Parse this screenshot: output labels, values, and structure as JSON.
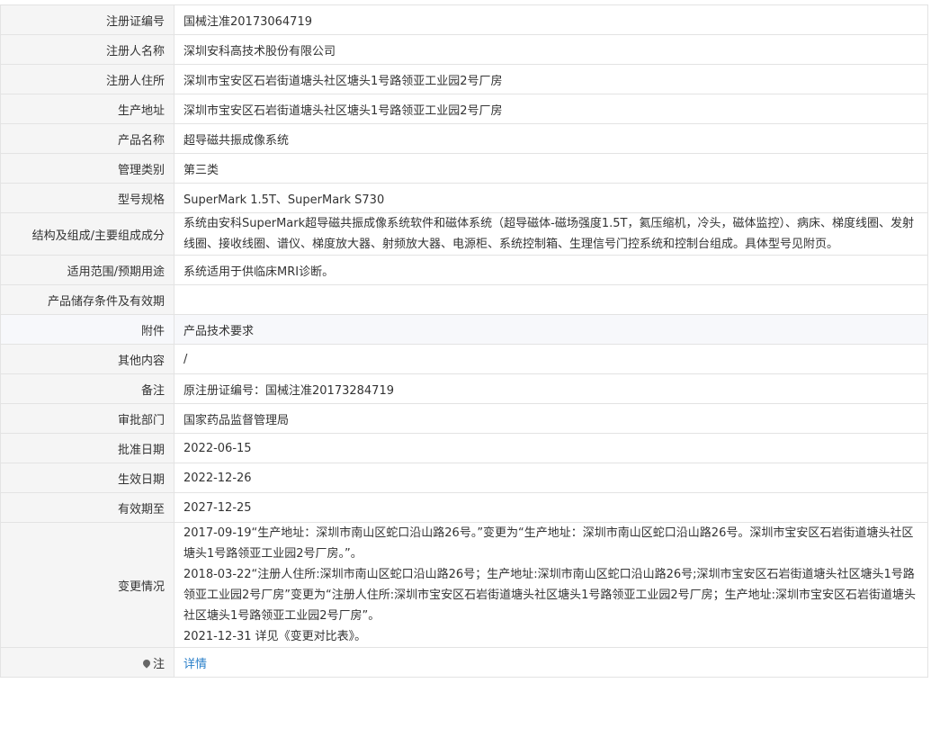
{
  "rows": [
    {
      "label": "注册证编号",
      "value": "国械注准20173064719"
    },
    {
      "label": "注册人名称",
      "value": "深圳安科高技术股份有限公司"
    },
    {
      "label": "注册人住所",
      "value": "深圳市宝安区石岩街道塘头社区塘头1号路领亚工业园2号厂房"
    },
    {
      "label": "生产地址",
      "value": "深圳市宝安区石岩街道塘头社区塘头1号路领亚工业园2号厂房"
    },
    {
      "label": "产品名称",
      "value": "超导磁共振成像系统"
    },
    {
      "label": "管理类别",
      "value": "第三类"
    },
    {
      "label": "型号规格",
      "value": "SuperMark 1.5T、SuperMark S730"
    },
    {
      "label": "结构及组成/主要组成成分",
      "value": "系统由安科SuperMark超导磁共振成像系统软件和磁体系统（超导磁体-磁场强度1.5T，氦压缩机，冷头，磁体监控）、病床、梯度线圈、发射线圈、接收线圈、谱仪、梯度放大器、射频放大器、电源柜、系统控制箱、生理信号门控系统和控制台组成。具体型号见附页。"
    },
    {
      "label": "适用范围/预期用途",
      "value": "系统适用于供临床MRI诊断。"
    },
    {
      "label": "产品储存条件及有效期",
      "value": ""
    },
    {
      "label": "附件",
      "value": "产品技术要求"
    },
    {
      "label": "其他内容",
      "value": "/"
    },
    {
      "label": "备注",
      "value": "原注册证编号：国械注准20173284719"
    },
    {
      "label": "审批部门",
      "value": "国家药品监督管理局"
    },
    {
      "label": "批准日期",
      "value": "2022-06-15"
    },
    {
      "label": "生效日期",
      "value": "2022-12-26"
    },
    {
      "label": "有效期至",
      "value": "2027-12-25"
    }
  ],
  "changes": {
    "label": "变更情况",
    "entries": [
      "2017-09-19“生产地址：深圳市南山区蛇口沿山路26号。”变更为“生产地址：深圳市南山区蛇口沿山路26号。深圳市宝安区石岩街道塘头社区塘头1号路领亚工业园2号厂房。”。",
      "2018-03-22“注册人住所:深圳市南山区蛇口沿山路26号；生产地址:深圳市南山区蛇口沿山路26号;深圳市宝安区石岩街道塘头社区塘头1号路领亚工业园2号厂房”变更为“注册人住所:深圳市宝安区石岩街道塘头社区塘头1号路领亚工业园2号厂房；生产地址:深圳市宝安区石岩街道塘头社区塘头1号路领亚工业园2号厂房”。",
      "2021-12-31 详见《变更对比表》。"
    ]
  },
  "note": {
    "label": "注",
    "icon": "map-pin-icon",
    "link_text": "详情"
  }
}
